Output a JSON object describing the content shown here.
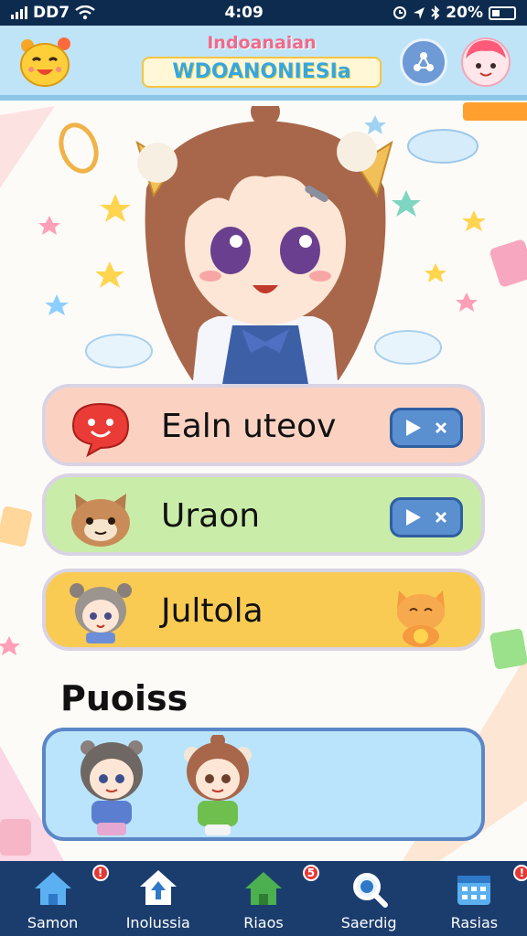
{
  "status_bar": {
    "carrier": "DD7",
    "time": "4:09",
    "battery": "20%"
  },
  "header": {
    "title_small": "Indoanaian",
    "title_big": "WDOANONIESIa"
  },
  "menu": [
    {
      "label": "Ealn uteov",
      "icon": "red-chat-bubble-icon",
      "has_play": true
    },
    {
      "label": "Uraon",
      "icon": "cat-face-icon",
      "has_play": true
    },
    {
      "label": "Jultola",
      "icon": "chibi-girl-icon",
      "has_play": false
    }
  ],
  "section": {
    "title": "Puoiss"
  },
  "bottom_nav": [
    {
      "label": "Samon",
      "icon": "home-icon",
      "badge": "!"
    },
    {
      "label": "Inolussia",
      "icon": "house-arrow-icon",
      "badge": ""
    },
    {
      "label": "Riaos",
      "icon": "green-house-icon",
      "badge": "5"
    },
    {
      "label": "Saerdig",
      "icon": "search-icon",
      "badge": ""
    },
    {
      "label": "Rasias",
      "icon": "calendar-icon",
      "badge": "!"
    }
  ],
  "colors": {
    "status_bar": "#0d2b4e",
    "header": "#bfe4f7",
    "row1": "#fbd2c2",
    "row2": "#c9eda8",
    "row3": "#f9cb53",
    "party_card": "#b9e4fb",
    "bottom_nav": "#1b3d6e",
    "play_button": "#5a8fd0"
  }
}
